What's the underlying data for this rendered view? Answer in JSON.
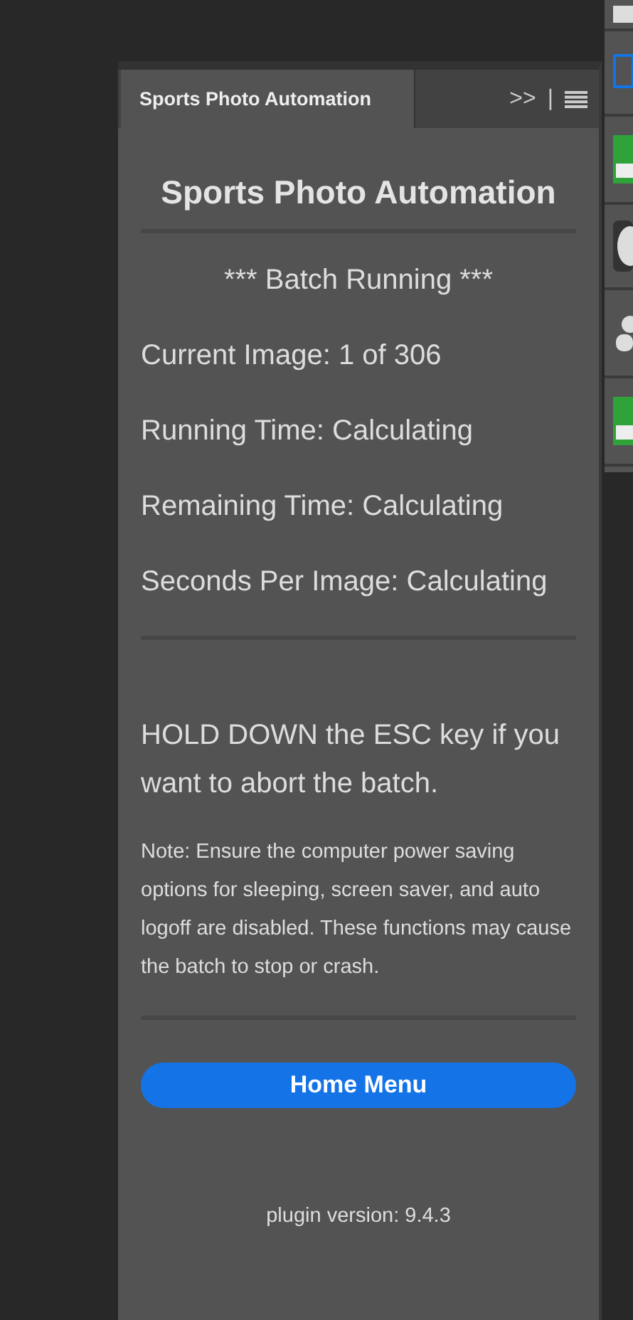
{
  "tab": {
    "label": "Sports Photo Automation",
    "selected": true
  },
  "header_icons": [
    ">>",
    "|"
  ],
  "title": "Sports Photo Automation",
  "status": "*** Batch Running ***",
  "stats": [
    "Current Image: 1 of 306",
    "Running Time: Calculating",
    "Remaining Time: Calculating",
    "Seconds Per Image: Calculating"
  ],
  "warning": "HOLD DOWN the ESC key if you want to abort the batch.",
  "note": "Note: Ensure the computer power saving options for sleeping, screen saver, and auto logoff are disabled. These functions may cause the batch to stop or crash.",
  "button": "Home Menu",
  "version": "plugin version: 9.4.3",
  "dock": [
    {
      "kind": "square"
    },
    {
      "kind": "frame"
    },
    {
      "kind": "green"
    },
    {
      "kind": "dial"
    },
    {
      "kind": "person"
    },
    {
      "kind": "green"
    }
  ]
}
